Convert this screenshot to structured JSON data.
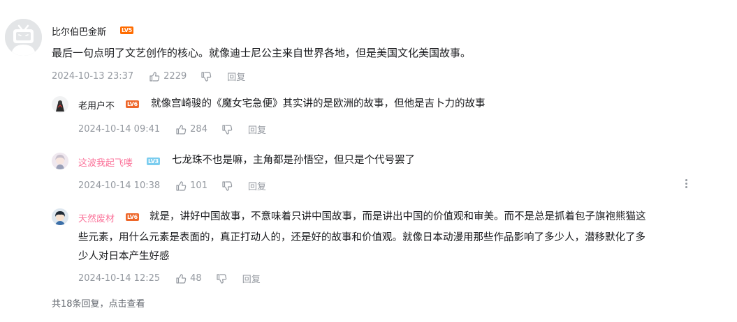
{
  "main_comment": {
    "username": "比尔伯巴金斯",
    "level": "LV5",
    "level_color": "#ff6c00",
    "content": "最后一句点明了文艺创作的核心。就像迪士尼公主来自世界各地，但是美国文化美国故事。",
    "time": "2024-10-13 23:37",
    "likes": "2229",
    "reply_label": "回复"
  },
  "replies": [
    {
      "username": "老用户不",
      "username_color": "#18191c",
      "level": "LV6",
      "level_color": "#ee672a",
      "text_line1": "就像宫崎骏的《魔女宅急便》其实讲的是欧洲的故事，但他是吉卜力的故事",
      "time": "2024-10-14 09:41",
      "likes": "284",
      "reply_label": "回复"
    },
    {
      "username": "这波我起飞喽",
      "username_color": "#fb7299",
      "level": "LV3",
      "level_color": "#7bcdef",
      "text_line1": "七龙珠不也是嘛，主角都是孙悟空，但只是个代号罢了",
      "time": "2024-10-14 10:38",
      "likes": "101",
      "reply_label": "回复"
    },
    {
      "username": "天然废材",
      "username_color": "#fb7299",
      "level": "LV6",
      "level_color": "#ee672a",
      "text_line1": "就是，讲好中国故事，不意味着只讲中国故事，而是讲出中国的价值观和审美。而不是总是抓着包子旗袍熊猫这",
      "text_line2": "些元素，用什么元素是表面的，真正打动人的，还是好的故事和价值观。就像日本动漫用那些作品影响了多少人，潜移默化了多",
      "text_line3": "少人对日本产生好感",
      "time": "2024-10-14 12:25",
      "likes": "48",
      "reply_label": "回复"
    }
  ],
  "summary": "共18条回复，点击查看",
  "icons": {
    "like": "thumbs-up-icon",
    "dislike": "thumbs-down-icon",
    "more": "more-vertical-icon"
  }
}
